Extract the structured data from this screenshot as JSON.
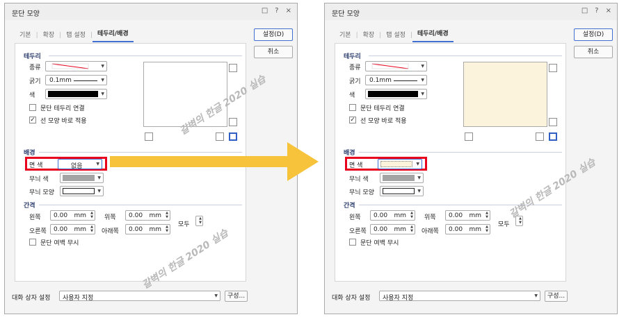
{
  "dialog": {
    "title": "문단 모양",
    "titlebar_icons": [
      "□",
      "?",
      "×"
    ],
    "tabs": [
      "기본",
      "확장",
      "탭 설정",
      "테두리/배경"
    ],
    "ok_label": "설정(D)",
    "cancel_label": "취소",
    "border": {
      "header": "테두리",
      "type_label": "종류",
      "width_label": "굵기",
      "width_value": "0.1mm",
      "color_label": "색",
      "link_label": "문단 테두리 연결",
      "apply_label": "선 모양 바로 적용"
    },
    "background": {
      "header": "배경",
      "fill_label": "면 색",
      "pattern_color_label": "무늬 색",
      "pattern_shape_label": "무늬 모양"
    },
    "spacing": {
      "header": "간격",
      "left_label": "왼쪽",
      "right_label": "오른쪽",
      "top_label": "위쪽",
      "bottom_label": "아래쪽",
      "all_label": "모두",
      "value": "0.00",
      "unit": "mm",
      "ignore_label": "문단 여백 무시"
    },
    "preset_label": "대화 상자 설정",
    "preset_value": "사용자 지정",
    "configure_label": "구성..."
  },
  "left_fill_value": "없음",
  "watermark_text": "갈벽의 한글 2020 실습",
  "colors": {
    "highlight": "#e8001c",
    "arrow": "#f7c33a",
    "preview_fill": "#fbf3dc",
    "accent": "#3f6fd1"
  }
}
